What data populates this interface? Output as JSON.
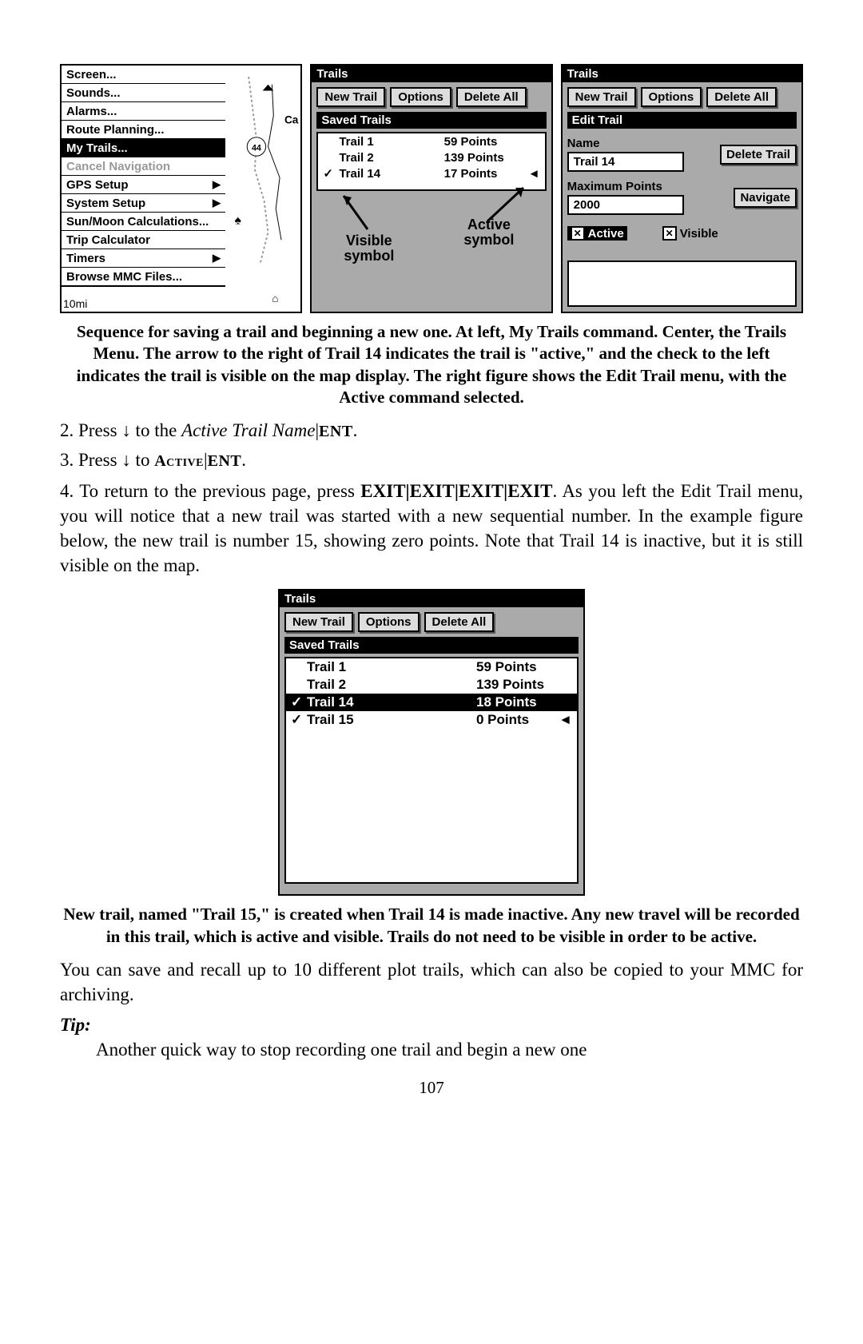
{
  "left_panel": {
    "menu": [
      {
        "label": "Screen...",
        "submenu": false
      },
      {
        "label": "Sounds...",
        "submenu": false
      },
      {
        "label": "Alarms...",
        "submenu": false
      },
      {
        "label": "Route Planning...",
        "submenu": false
      },
      {
        "label": "My Trails...",
        "submenu": false,
        "selected": true
      },
      {
        "label": "Cancel Navigation",
        "submenu": false,
        "disabled": true
      },
      {
        "label": "GPS Setup",
        "submenu": true
      },
      {
        "label": "System Setup",
        "submenu": true
      },
      {
        "label": "Sun/Moon Calculations...",
        "submenu": false
      },
      {
        "label": "Trip Calculator",
        "submenu": false
      },
      {
        "label": "Timers",
        "submenu": true
      },
      {
        "label": "Browse MMC Files...",
        "submenu": false
      }
    ],
    "map_label_ca": "Ca",
    "map_shield": "44",
    "scale": "10mi"
  },
  "mid_panel": {
    "title": "Trails",
    "buttons": {
      "new": "New Trail",
      "options": "Options",
      "delete": "Delete All"
    },
    "subheader": "Saved Trails",
    "rows": [
      {
        "check": "",
        "name": "Trail 1",
        "pts": "59 Points",
        "active": ""
      },
      {
        "check": "",
        "name": "Trail 2",
        "pts": "139 Points",
        "active": ""
      },
      {
        "check": "✓",
        "name": "Trail 14",
        "pts": "17 Points",
        "active": "◄"
      }
    ],
    "annot_visible": "Visible\nsymbol",
    "annot_active": "Active\nsymbol"
  },
  "right_panel": {
    "title": "Trails",
    "buttons": {
      "new": "New Trail",
      "options": "Options",
      "delete": "Delete All"
    },
    "subheader": "Edit Trail",
    "name_label": "Name",
    "name_value": "Trail 14",
    "delete_trail": "Delete Trail",
    "max_label": "Maximum Points",
    "max_value": "2000",
    "navigate": "Navigate",
    "active_label": "Active",
    "visible_label": "Visible"
  },
  "caption1": "Sequence for saving a trail and beginning a new one. At left, My Trails command. Center, the Trails Menu. The arrow to the right of Trail 14 indicates the trail is \"active,\" and the check to the left indicates the trail is visible on the map display. The right figure shows the Edit Trail menu, with the Active command selected.",
  "step2": {
    "prefix": "2. Press ↓ to the ",
    "italic": "Active Trail Name",
    "tail": "ENT"
  },
  "step3": {
    "prefix": "3. Press ↓ to ",
    "sc1": "Active",
    "sc2": "ENT"
  },
  "step4": "4. To return to the previous page, press EXIT|EXIT|EXIT|EXIT. As you left the Edit Trail menu, you will notice that a new trail was started with a new sequential number. In the example figure below, the new trail is number 15, showing zero points. Note that Trail 14 is inactive, but it is still visible on the map.",
  "step4_bold": "EXIT|EXIT|EXIT|EXIT",
  "fig2": {
    "title": "Trails",
    "buttons": {
      "new": "New Trail",
      "options": "Options",
      "delete": "Delete All"
    },
    "subheader": "Saved Trails",
    "rows": [
      {
        "check": "",
        "name": "Trail 1",
        "pts": "59 Points",
        "active": "",
        "sel": false
      },
      {
        "check": "",
        "name": "Trail 2",
        "pts": "139 Points",
        "active": "",
        "sel": false
      },
      {
        "check": "✓",
        "name": "Trail 14",
        "pts": "18 Points",
        "active": "",
        "sel": true
      },
      {
        "check": "✓",
        "name": "Trail 15",
        "pts": "0 Points",
        "active": "◄",
        "sel": false
      }
    ]
  },
  "caption2": "New trail, named \"Trail 15,\" is created when Trail 14 is made inactive. Any new travel will be recorded in this trail, which is active and visible. Trails do not need to be visible in order to be active.",
  "para": "You can save and recall up to 10 different plot trails, which can also be copied to your MMC for archiving.",
  "tip_label": "Tip:",
  "tip_text": "Another quick way to stop recording one trail and begin a new one",
  "page_num": "107"
}
